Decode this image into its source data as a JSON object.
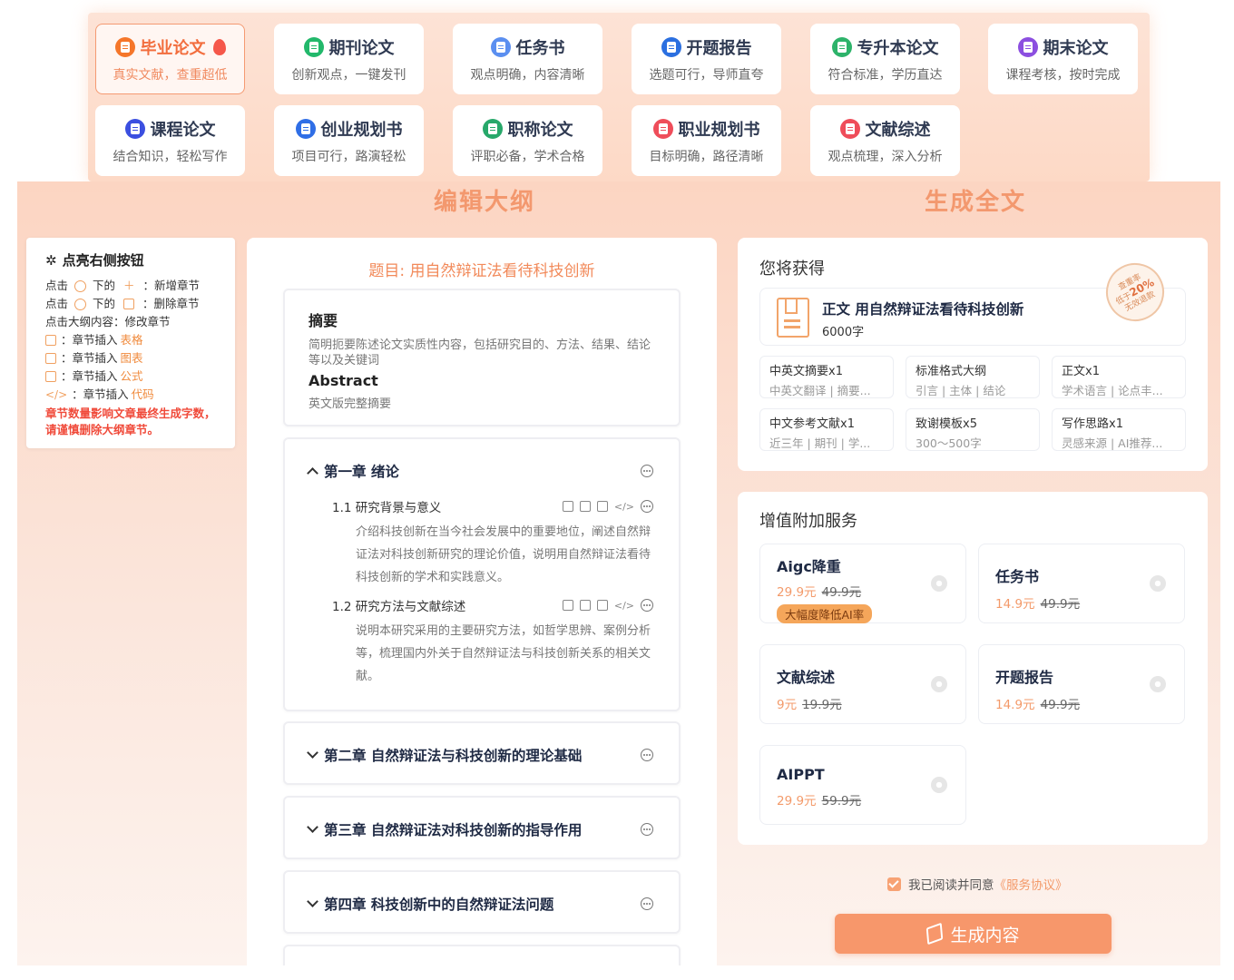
{
  "doc_types": [
    {
      "title": "毕业论文",
      "sub": "真实文献，查重超低",
      "color": "#f5762a",
      "icon": "book-icon",
      "hot": true
    },
    {
      "title": "期刊论文",
      "sub": "创新观点，一键发刊",
      "color": "#22b86b",
      "icon": "document-icon"
    },
    {
      "title": "任务书",
      "sub": "观点明确，内容清晰",
      "color": "#5b8ff0",
      "icon": "task-icon"
    },
    {
      "title": "开题报告",
      "sub": "选题可行，导师直夸",
      "color": "#2b6fe0",
      "icon": "report-icon"
    },
    {
      "title": "专升本论文",
      "sub": "符合标准，学历直达",
      "color": "#2db36a",
      "icon": "book-open-icon"
    },
    {
      "title": "期末论文",
      "sub": "课程考核，按时完成",
      "color": "#8c4fe0",
      "icon": "document-icon"
    },
    {
      "title": "课程论文",
      "sub": "结合知识，轻松写作",
      "color": "#3b4fe0",
      "icon": "course-icon"
    },
    {
      "title": "创业规划书",
      "sub": "项目可行，路演轻松",
      "color": "#2f6ee6",
      "icon": "plan-icon"
    },
    {
      "title": "职称论文",
      "sub": "评职必备，学术合格",
      "color": "#27a86a",
      "icon": "certificate-icon"
    },
    {
      "title": "职业规划书",
      "sub": "目标明确，路径清晰",
      "color": "#ef4d5a",
      "icon": "career-icon"
    },
    {
      "title": "文献综述",
      "sub": "观点梳理，深入分析",
      "color": "#ef4d5a",
      "icon": "review-icon"
    }
  ],
  "sections": {
    "outline": "编辑大纲",
    "fulltext": "生成全文"
  },
  "tips": {
    "title": "点亮右侧按钮",
    "line1": {
      "a": "点击",
      "b": "下的",
      "c": "：新增章节"
    },
    "line2": {
      "a": "点击",
      "b": "下的",
      "c": "：删除章节"
    },
    "line3": "点击大纲内容：修改章节",
    "line4": {
      "a": "：章节插入",
      "b": "表格"
    },
    "line5": {
      "a": "：章节插入",
      "b": "图表"
    },
    "line6": {
      "a": "：章节插入",
      "b": "公式"
    },
    "line7": {
      "a": "：章节插入",
      "b": "代码"
    },
    "warn": "章节数量影响文章最终生成字数，请谨慎删除大纲章节。"
  },
  "outline": {
    "topic": "题目: 用自然辩证法看待科技创新",
    "abstract": {
      "title": "摘要",
      "text": "简明扼要陈述论文实质性内容，包括研究目的、方法、结果、结论等以及关键词",
      "en_title": "Abstract",
      "en_text": "英文版完整摘要"
    },
    "chapter1": {
      "title": "第一章  绪论",
      "s1_title": "1.1  研究背景与意义",
      "s1_text": "介绍科技创新在当今社会发展中的重要地位，阐述自然辩证法对科技创新研究的理论价值，说明用自然辩证法看待科技创新的学术和实践意义。",
      "s2_title": "1.2  研究方法与文献综述",
      "s2_text": "说明本研究采用的主要研究方法，如哲学思辨、案例分析等，梳理国内外关于自然辩证法与科技创新关系的相关文献。"
    },
    "chapter2": "第二章  自然辩证法与科技创新的理论基础",
    "chapter3": "第三章  自然辩证法对科技创新的指导作用",
    "chapter4": "第四章  科技创新中的自然辩证法问题"
  },
  "get": {
    "heading": "您将获得",
    "main_title": "正文 用自然辩证法看待科技创新",
    "main_sub": "6000字",
    "stamp": {
      "l1": "查重率",
      "l2": "低于",
      "pct": "20%",
      "l3": "无效退款"
    },
    "items": [
      {
        "t": "中英文摘要x1",
        "s": "中英文翻译 | 摘要..."
      },
      {
        "t": "标准格式大纲",
        "s": "引言 | 主体 | 结论"
      },
      {
        "t": "正文x1",
        "s": "学术语言 | 论点丰..."
      },
      {
        "t": "中文参考文献x1",
        "s": "近三年 | 期刊 | 学..."
      },
      {
        "t": "致谢模板x5",
        "s": "300～500字"
      },
      {
        "t": "写作思路x1",
        "s": "灵感来源 | AI推荐..."
      }
    ]
  },
  "services": {
    "heading": "增值附加服务",
    "items": [
      {
        "name": "Aigc降重",
        "price": "29.9元",
        "orig": "49.9元",
        "tag": "大幅度降低AI率"
      },
      {
        "name": "任务书",
        "price": "14.9元",
        "orig": "49.9元"
      },
      {
        "name": "文献综述",
        "price": "9元",
        "orig": "19.9元"
      },
      {
        "name": "开题报告",
        "price": "14.9元",
        "orig": "49.9元"
      },
      {
        "name": "AIPPT",
        "price": "29.9元",
        "orig": "59.9元"
      }
    ]
  },
  "agree": {
    "text": "我已阅读并同意",
    "link": "《服务协议》",
    "checked": true
  },
  "generate_label": "生成内容"
}
